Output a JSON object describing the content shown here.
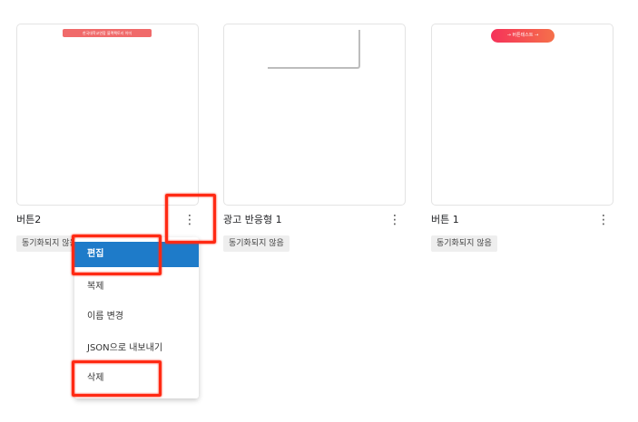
{
  "cards": [
    {
      "title": "버튼2",
      "status": "동기화되지 않음",
      "preview_text": "한국대학교연합 블랙팩토리 이미"
    },
    {
      "title": "광고 반응형 1",
      "status": "동기화되지 않음"
    },
    {
      "title": "버튼 1",
      "status": "동기화되지 않음",
      "preview_text": "→ 버튼테스트 →"
    }
  ],
  "more_icon": "⋮",
  "context_menu": {
    "items": [
      {
        "label": "편집",
        "active": true
      },
      {
        "label": "복제"
      },
      {
        "label": "이름 변경"
      },
      {
        "label": "JSON으로 내보내기"
      },
      {
        "label": "삭제"
      }
    ]
  },
  "colors": {
    "menu_active": "#1e7bc9",
    "highlight": "#ff2a14",
    "button_preview": "#f5325a"
  },
  "icons": {
    "more": "more-vert-icon"
  }
}
